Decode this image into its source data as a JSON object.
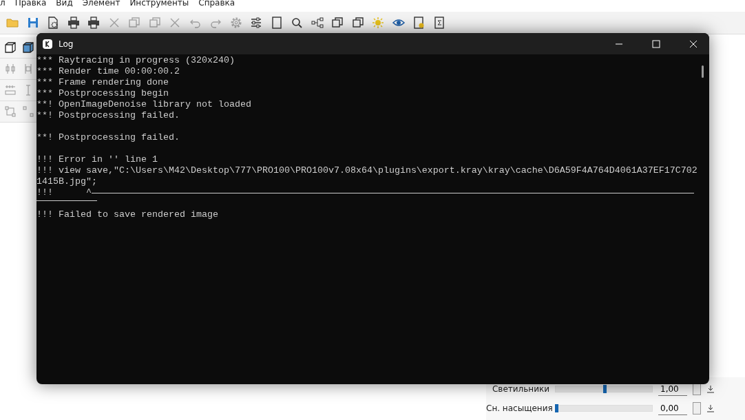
{
  "menu": [
    {
      "label": "л"
    },
    {
      "label": "Правка"
    },
    {
      "label": "Вид"
    },
    {
      "label": "Элемент"
    },
    {
      "label": "Инструменты"
    },
    {
      "label": "Справка"
    }
  ],
  "toolbar": [
    {
      "disabled": false
    },
    {
      "disabled": false
    },
    {
      "disabled": false
    },
    {
      "disabled": false
    },
    {
      "disabled": false
    },
    {
      "disabled": true
    },
    {
      "disabled": true
    },
    {
      "disabled": true
    },
    {
      "disabled": true
    },
    {
      "disabled": true
    },
    {
      "disabled": true
    },
    {
      "disabled": true
    },
    {
      "disabled": false
    },
    {
      "disabled": false
    },
    {
      "disabled": false
    },
    {
      "disabled": false
    },
    {
      "disabled": false
    },
    {
      "disabled": false
    },
    {
      "disabled": false
    },
    {
      "disabled": false
    },
    {
      "disabled": false
    },
    {
      "disabled": false
    }
  ],
  "panel": {
    "sliders": [
      {
        "label": "Светильники",
        "level": 0.5,
        "value": "1,00"
      },
      {
        "label": "Сн. насыщения",
        "level": 0,
        "value": "0,00"
      }
    ]
  },
  "log": {
    "title": "Log",
    "lines": [
      {
        "kind": "text",
        "text": "*** Raytracing in progress (320x240)"
      },
      {
        "kind": "text",
        "text": "*** Render time 00:00:00.2"
      },
      {
        "kind": "text",
        "text": "*** Frame rendering done"
      },
      {
        "kind": "text",
        "text": "*** Postprocessing begin"
      },
      {
        "kind": "text",
        "text": "**! OpenImageDenoise library not loaded"
      },
      {
        "kind": "text",
        "text": "**! Postprocessing failed."
      },
      {
        "kind": "blank"
      },
      {
        "kind": "text",
        "text": "**! Postprocessing failed."
      },
      {
        "kind": "blank"
      },
      {
        "kind": "text",
        "text": "!!! Error in '' line 1"
      },
      {
        "kind": "text",
        "text": "!!! view save,\"C:\\Users\\M42\\Desktop\\777\\PRO100\\PRO100v7.08x64\\plugins\\export.kray\\kray\\cache\\D6A59F4A764D4061A37EF17C702"
      },
      {
        "kind": "text",
        "text": "1415B.jpg\";"
      },
      {
        "kind": "caret",
        "text": "!!!      ^"
      },
      {
        "kind": "rule"
      },
      {
        "kind": "text",
        "text": "!!! Failed to save rendered image"
      }
    ]
  }
}
